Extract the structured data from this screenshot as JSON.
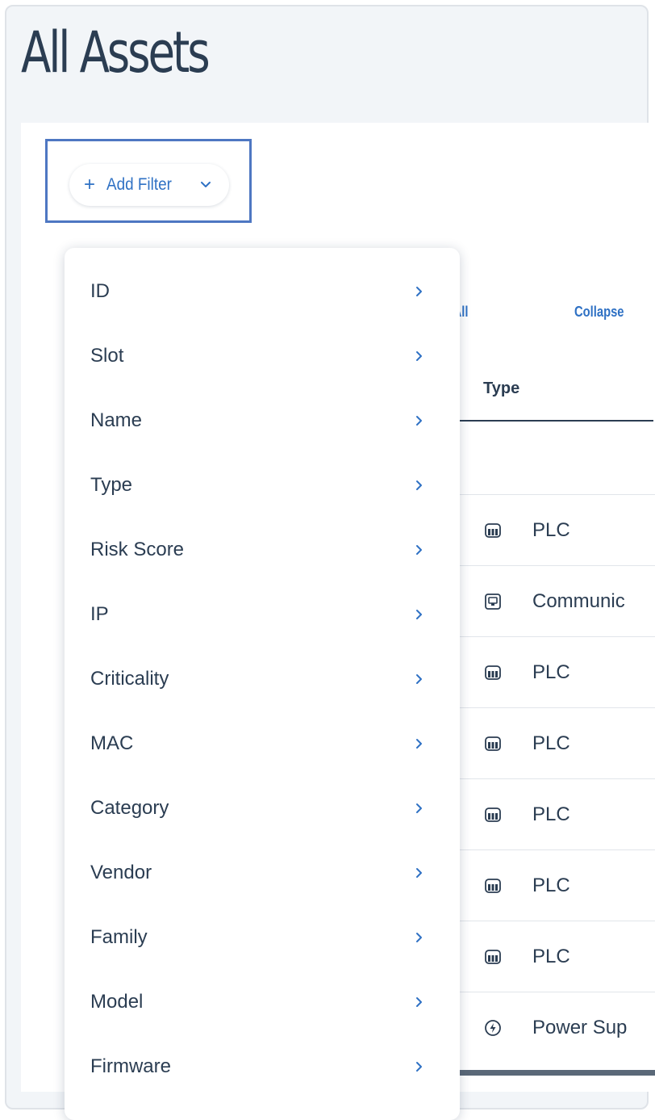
{
  "header": {
    "title": "All Assets"
  },
  "filter": {
    "add_filter_label": "Add Filter",
    "plus_glyph": "+"
  },
  "toolbar": {
    "expand_all_label": "nd All",
    "collapse_all_label": "Collapse"
  },
  "table": {
    "type_column_header": "Type",
    "rows": [
      {
        "type": "PLC",
        "icon": "plc-icon"
      },
      {
        "type": "Communic",
        "icon": "communication-module-icon"
      },
      {
        "type": "PLC",
        "icon": "plc-icon"
      },
      {
        "type": "PLC",
        "icon": "plc-icon"
      },
      {
        "type": "PLC",
        "icon": "plc-icon"
      },
      {
        "type": "PLC",
        "icon": "plc-icon"
      },
      {
        "type": "PLC",
        "icon": "plc-icon"
      },
      {
        "type": "Power Sup",
        "icon": "power-supply-icon"
      }
    ]
  },
  "filter_menu": {
    "items": [
      {
        "label": "ID"
      },
      {
        "label": "Slot"
      },
      {
        "label": "Name"
      },
      {
        "label": "Type"
      },
      {
        "label": "Risk Score"
      },
      {
        "label": "IP"
      },
      {
        "label": "Criticality"
      },
      {
        "label": "MAC"
      },
      {
        "label": "Category"
      },
      {
        "label": "Vendor"
      },
      {
        "label": "Family"
      },
      {
        "label": "Model"
      },
      {
        "label": "Firmware"
      }
    ]
  },
  "colors": {
    "accent": "#2f71c4",
    "text": "#2b3d52",
    "highlight_border": "#4e77c2",
    "page_background": "#f2f5f8"
  }
}
